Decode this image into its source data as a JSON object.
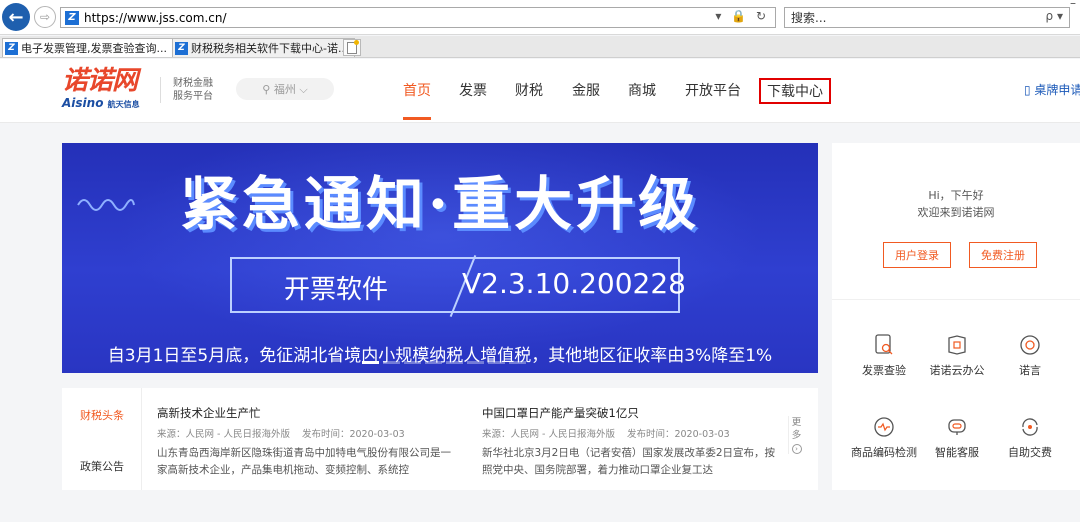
{
  "browser": {
    "back_glyph": "←",
    "forward_glyph": "⇨",
    "favicon_glyph": "Z",
    "url_prefix": "https://www.",
    "url_domain": "jss.com.cn",
    "url_suffix": "/",
    "url_icons": "▾ 🔒 ↻",
    "search_placeholder": "搜索...",
    "search_icon": "ρ ▾",
    "minimize": "–",
    "tabs": [
      {
        "label": "电子发票管理,发票查验查询...",
        "close": "×"
      },
      {
        "label": "财税税务相关软件下载中心-诺..."
      }
    ]
  },
  "site": {
    "logo_cn": "诺诺网",
    "logo_en": "Aisino",
    "logo_en_sub": "航天信息",
    "slogan_line1": "财税金融",
    "slogan_line2": "服务平台",
    "city": "⚲ 福州 ⌵",
    "nav": [
      "首页",
      "发票",
      "财税",
      "金服",
      "商城",
      "开放平台",
      "下载中心"
    ],
    "desk_link": "▯ 桌牌申请"
  },
  "banner": {
    "title": "紧急通知·重大升级",
    "software": "开票软件",
    "version": "V2.3.10.200228",
    "subtitle": "自3月1日至5月底，免征湖北省境内小规模纳税人增值税，其他地区征收率由3%降至1%",
    "slides": 8,
    "active_slide": 0
  },
  "panel": {
    "greet_line1": "Hi，下午好",
    "greet_line2": "欢迎来到诺诺网",
    "login": "用户登录",
    "register": "免费注册",
    "items": [
      {
        "label": "发票查验",
        "icon": "invoice-check-icon"
      },
      {
        "label": "诺诺云办公",
        "icon": "cloud-office-icon"
      },
      {
        "label": "诺言",
        "icon": "message-icon"
      },
      {
        "label": "商品编码检测",
        "icon": "code-check-icon"
      },
      {
        "label": "智能客服",
        "icon": "customer-service-icon"
      },
      {
        "label": "自助交费",
        "icon": "self-pay-icon"
      }
    ]
  },
  "news": {
    "tabs": [
      "财税头条",
      "政策公告"
    ],
    "items": [
      {
        "title": "高新技术企业生产忙",
        "source": "来源：人民网 - 人民日报海外版",
        "time": "发布时间：2020-03-03",
        "body": "山东青岛西海岸新区隐珠街道青岛中加特电气股份有限公司是一家高新技术企业，产品集电机拖动、变频控制、系统控"
      },
      {
        "title": "中国口罩日产能产量突破1亿只",
        "source": "来源：人民网 - 人民日报海外版",
        "time": "发布时间：2020-03-03",
        "body": "新华社北京3月2日电（记者安蓓）国家发展改革委2日宣布，按照党中央、国务院部署，着力推动口罩企业复工达"
      }
    ],
    "more_1": "更",
    "more_2": "多",
    "more_icon": "›"
  }
}
